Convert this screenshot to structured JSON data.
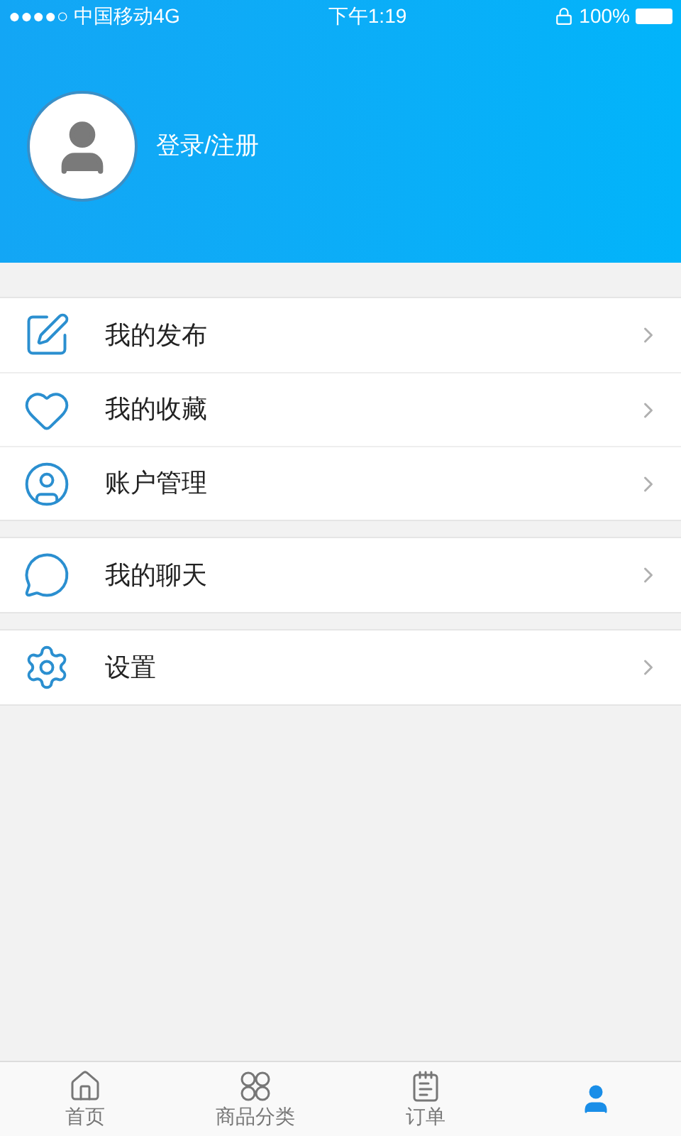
{
  "status_bar": {
    "carrier": "●●●●○ 中国移动4G",
    "time": "下午1:19",
    "battery": "100%"
  },
  "profile": {
    "login_label": "登录/注册"
  },
  "menu_groups": [
    {
      "items": [
        {
          "label": "我的发布"
        },
        {
          "label": "我的收藏"
        },
        {
          "label": "账户管理"
        }
      ]
    },
    {
      "items": [
        {
          "label": "我的聊天"
        }
      ]
    },
    {
      "items": [
        {
          "label": "设置"
        }
      ]
    }
  ],
  "tab_bar": [
    {
      "label": "首页",
      "selected": false
    },
    {
      "label": "商品分类",
      "selected": false
    },
    {
      "label": "订单",
      "selected": false
    },
    {
      "selected": true
    }
  ]
}
